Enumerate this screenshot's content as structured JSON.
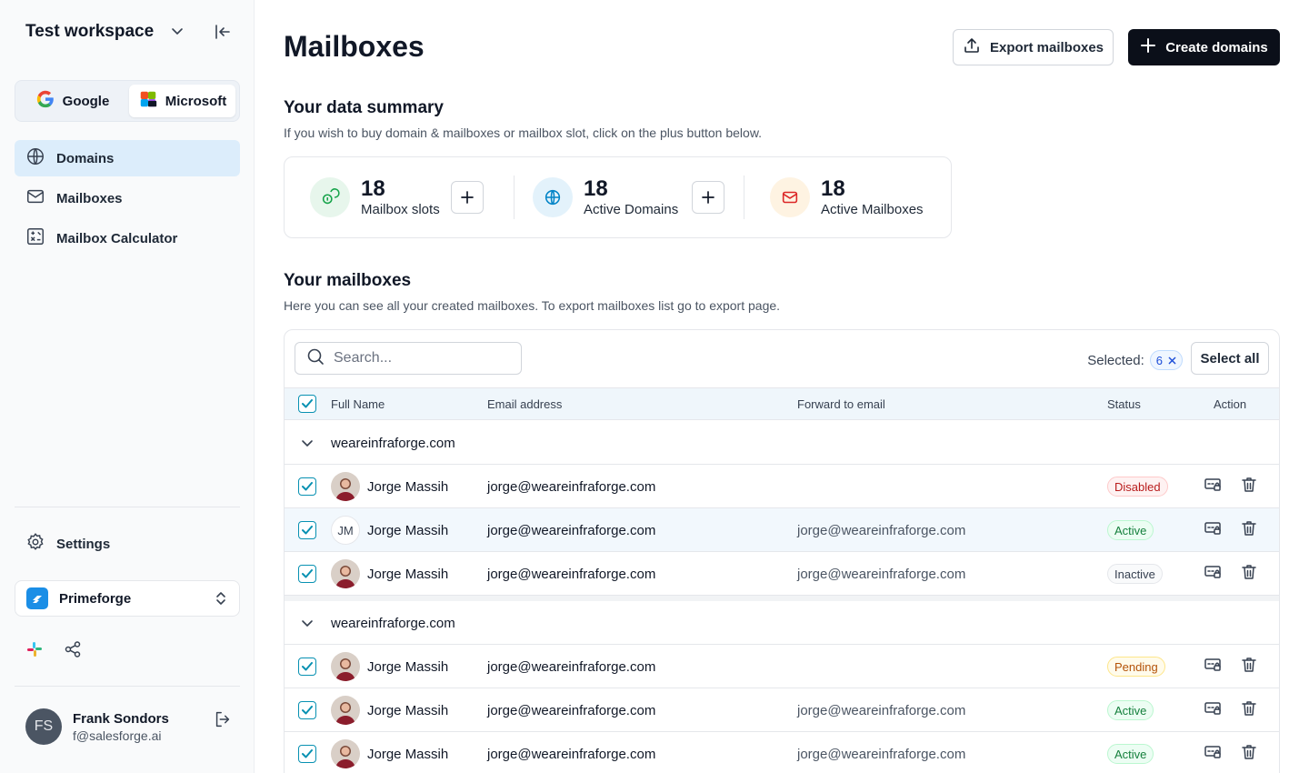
{
  "sidebar": {
    "workspace": "Test workspace",
    "providers": [
      {
        "label": "Google",
        "icon": "google-icon",
        "active": false
      },
      {
        "label": "Microsoft",
        "icon": "microsoft-icon",
        "active": true
      }
    ],
    "nav": [
      {
        "label": "Domains",
        "icon": "globe-icon",
        "active": true
      },
      {
        "label": "Mailboxes",
        "icon": "mail-icon",
        "active": false
      },
      {
        "label": "Mailbox Calculator",
        "icon": "calculator-icon",
        "active": false
      }
    ],
    "settings": "Settings",
    "org": "Primeforge",
    "user": {
      "initials": "FS",
      "name": "Frank Sondors",
      "email": "f@salesforge.ai"
    }
  },
  "header": {
    "title": "Mailboxes",
    "export_label": "Export mailboxes",
    "create_label": "Create domains"
  },
  "summary": {
    "title": "Your data summary",
    "description": "If you wish to buy domain & mailboxes or mailbox slot, click on the plus button below.",
    "stats": [
      {
        "value": "18",
        "label": "Mailbox slots",
        "icon": "coins-icon",
        "color": "#16a34a"
      },
      {
        "value": "18",
        "label": "Active Domains",
        "icon": "globe-icon",
        "color": "#0284c7"
      },
      {
        "value": "18",
        "label": "Active Mailboxes",
        "icon": "mail-icon",
        "color": "#dc2626"
      }
    ]
  },
  "mailboxes": {
    "title": "Your mailboxes",
    "description": "Here you can see all your created mailboxes. To export mailboxes list go to export page.",
    "search_placeholder": "Search...",
    "selected_label": "Selected:",
    "selected_count": "6",
    "select_all_label": "Select all",
    "columns": {
      "name": "Full Name",
      "email": "Email address",
      "forward": "Forward to email",
      "status": "Status",
      "action": "Action"
    },
    "groups": [
      {
        "domain": "weareinfraforge.com",
        "rows": [
          {
            "name": "Jorge Massih",
            "avatar": "photo",
            "email": "jorge@weareinfraforge.com",
            "forward": "",
            "status": "Disabled"
          },
          {
            "name": "Jorge Massih",
            "avatar": "JM",
            "email": "jorge@weareinfraforge.com",
            "forward": "jorge@weareinfraforge.com",
            "status": "Active"
          },
          {
            "name": "Jorge Massih",
            "avatar": "photo",
            "email": "jorge@weareinfraforge.com",
            "forward": "jorge@weareinfraforge.com",
            "status": "Inactive"
          }
        ]
      },
      {
        "domain": "weareinfraforge.com",
        "rows": [
          {
            "name": "Jorge Massih",
            "avatar": "photo",
            "email": "jorge@weareinfraforge.com",
            "forward": "",
            "status": "Pending"
          },
          {
            "name": "Jorge Massih",
            "avatar": "photo",
            "email": "jorge@weareinfraforge.com",
            "forward": "jorge@weareinfraforge.com",
            "status": "Active"
          },
          {
            "name": "Jorge Massih",
            "avatar": "photo",
            "email": "jorge@weareinfraforge.com",
            "forward": "jorge@weareinfraforge.com",
            "status": "Active"
          }
        ]
      }
    ]
  }
}
